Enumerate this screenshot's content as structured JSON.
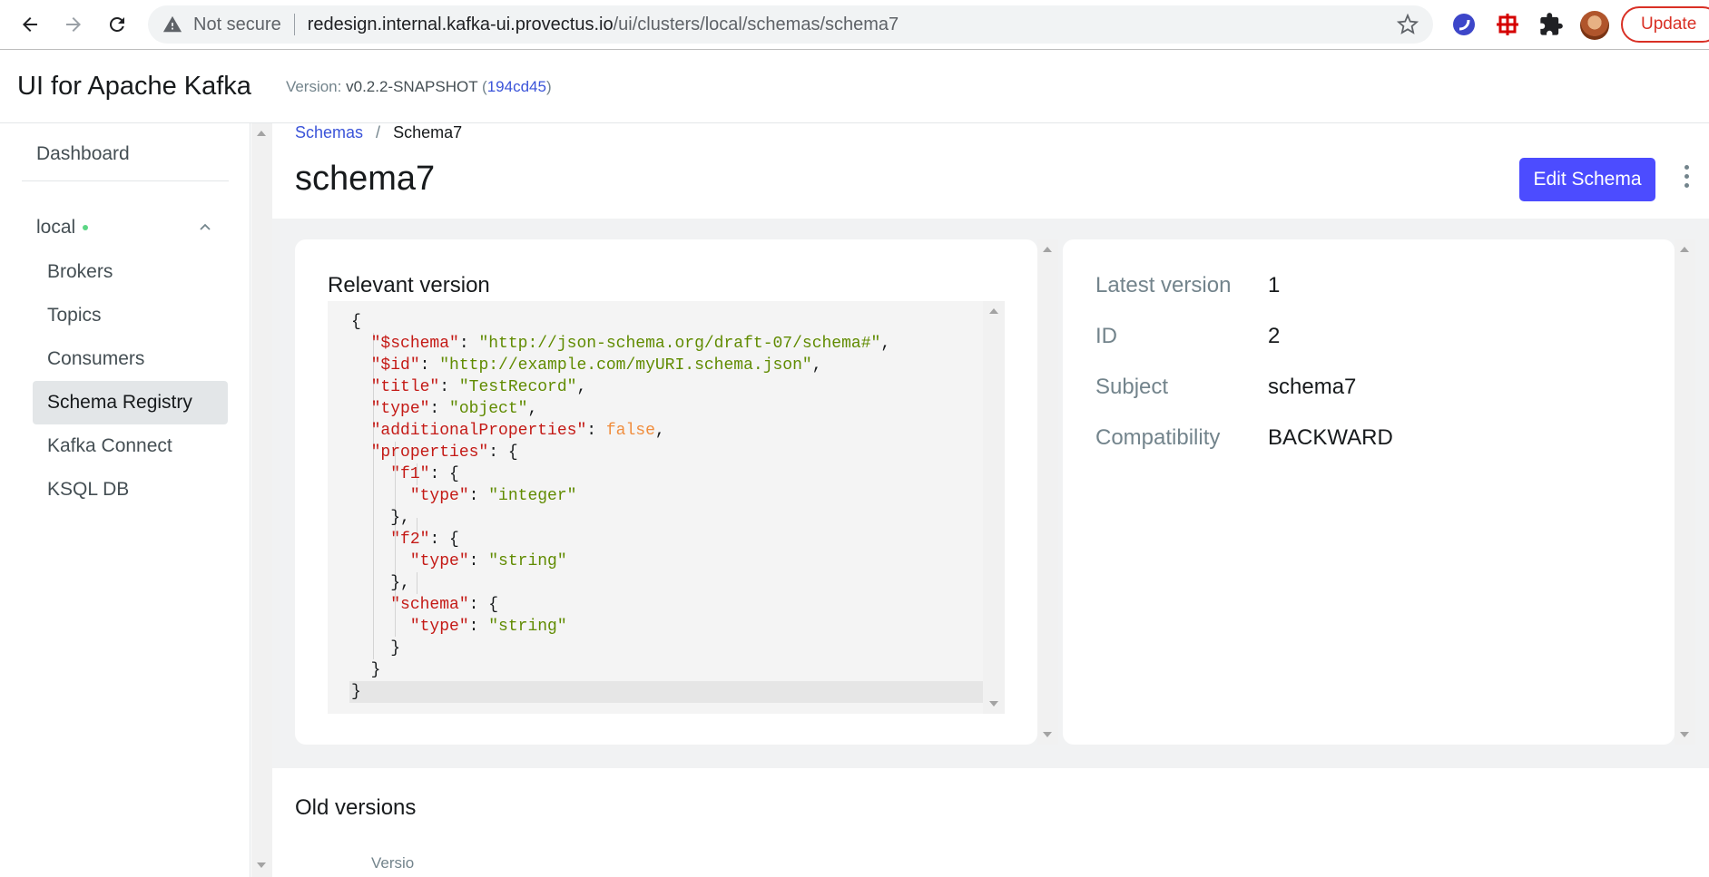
{
  "browser": {
    "not_secure": "Not secure",
    "url_host": "redesign.internal.kafka-ui.provectus.io",
    "url_path": "/ui/clusters/local/schemas/schema7",
    "update_label": "Update"
  },
  "header": {
    "app_title": "UI for Apache Kafka",
    "version_prefix": "Version:",
    "version": "v0.2.2-SNAPSHOT",
    "commit_open": "(",
    "commit": "194cd45",
    "commit_close": ")"
  },
  "sidebar": {
    "dashboard": "Dashboard",
    "cluster": "local",
    "items": [
      "Brokers",
      "Topics",
      "Consumers",
      "Schema Registry",
      "Kafka Connect",
      "KSQL DB"
    ],
    "active_index": 3
  },
  "breadcrumb": {
    "parent": "Schemas",
    "separator": "/",
    "current": "Schema7"
  },
  "page": {
    "title": "schema7",
    "edit_button": "Edit Schema"
  },
  "relevant_version": {
    "title": "Relevant version"
  },
  "details": {
    "latest_version_label": "Latest version",
    "latest_version": "1",
    "id_label": "ID",
    "id": "2",
    "subject_label": "Subject",
    "subject": "schema7",
    "compatibility_label": "Compatibility",
    "compatibility": "BACKWARD"
  },
  "old_versions": {
    "title": "Old versions",
    "column_version": "Versio"
  },
  "colors": {
    "accent": "#4c4cff",
    "link": "#3b54d9",
    "status_online": "#5cd685",
    "json_key": "#c41a16",
    "json_string": "#608b00",
    "json_bool": "#f08d3d"
  }
}
